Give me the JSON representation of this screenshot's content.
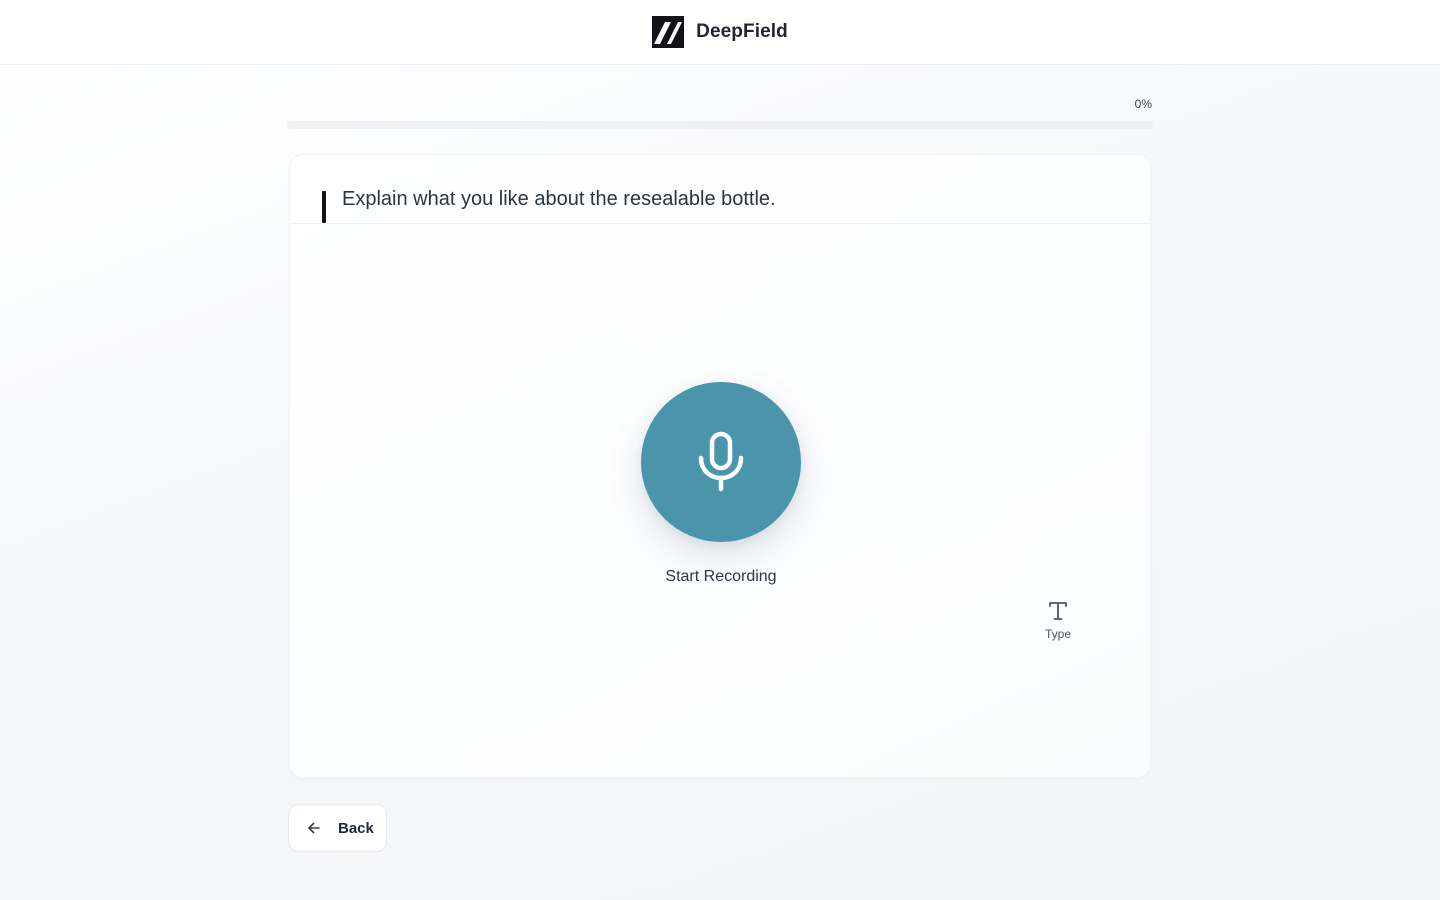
{
  "header": {
    "brand_name": "DeepField",
    "logo_icon": "deepfield-logo-icon"
  },
  "progress": {
    "label": "0%",
    "value": 0
  },
  "question": {
    "text": "Explain what you like about the resealable bottle."
  },
  "recorder": {
    "mic_icon": "microphone-icon",
    "start_label": "Start Recording"
  },
  "type_toggle": {
    "icon": "text-type-icon",
    "label": "Type"
  },
  "navigation": {
    "back_icon": "arrow-left-icon",
    "back_label": "Back"
  },
  "colors": {
    "accent": "#4a95ab",
    "brand_dark": "#111318",
    "text": "#2b3440"
  }
}
